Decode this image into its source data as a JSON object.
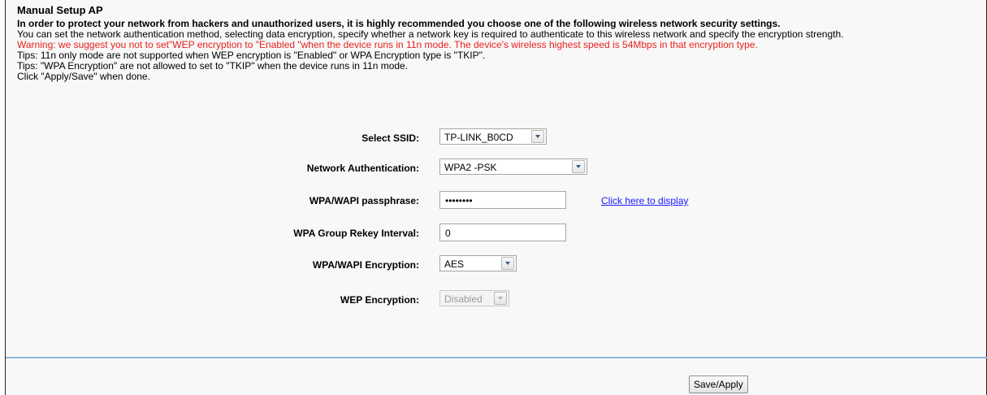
{
  "page": {
    "title": "Manual Setup AP",
    "intro_bold": "In order to protect your network from hackers and unauthorized users, it is highly recommended you choose one of the following wireless network security settings.",
    "intro_text": "You can set the network authentication method, selecting data encryption, specify whether a network key is required to authenticate to this wireless network and specify the encryption strength.",
    "warning": "Warning: we suggest you not to set\"WEP encryption to \"Enabled \"when the device runs in 11n mode. The device's wireless highest speed is 54Mbps in that encryption type.",
    "tip1": "Tips: 11n only mode are not supported when WEP encryption is \"Enabled\" or WPA Encryption type is \"TKIP\".",
    "tip2": "Tips: \"WPA Encryption\" are not allowed to set to \"TKIP\" when the device runs in 11n mode.",
    "tip3": "Click \"Apply/Save\" when done."
  },
  "form": {
    "ssid": {
      "label": "Select SSID:",
      "value": "TP-LINK_B0CD"
    },
    "auth": {
      "label": "Network Authentication:",
      "value": "WPA2 -PSK"
    },
    "passphrase": {
      "label": "WPA/WAPI passphrase:",
      "value": "••••••••",
      "link": "Click here to display"
    },
    "rekey": {
      "label": "WPA Group Rekey Interval:",
      "value": "0"
    },
    "encryption": {
      "label": "WPA/WAPI Encryption:",
      "value": "AES"
    },
    "wep": {
      "label": "WEP Encryption:",
      "value": "Disabled"
    }
  },
  "actions": {
    "save_label": "Save/Apply"
  },
  "colors": {
    "warning": "#e8211e",
    "link": "#1a1aff",
    "divider": "#90b8d4"
  },
  "icons": {
    "dropdown": "chevron-down-icon"
  }
}
